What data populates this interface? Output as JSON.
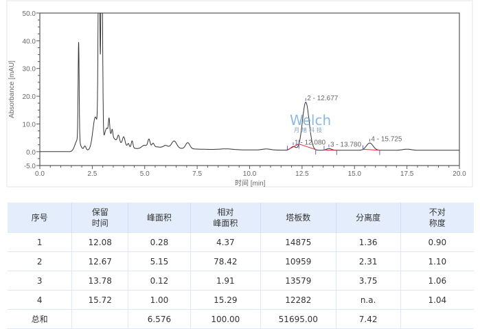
{
  "chart_data": {
    "type": "line",
    "xlabel": "时间 [min]",
    "ylabel": "Absorbance [mAU]",
    "xlim": [
      0,
      20
    ],
    "ylim": [
      -5,
      50
    ],
    "x_ticks": [
      "0.0",
      "2.5",
      "5.0",
      "7.5",
      "10.0",
      "12.5",
      "15.0",
      "17.5",
      "20.0"
    ],
    "y_ticks": [
      "50.0",
      "40.0",
      "30.0",
      "20.0",
      "10.0",
      "0.0",
      "-5.0"
    ],
    "grid": false,
    "line_color": "#333333",
    "integration_color": "#e8262a",
    "marker_color": "#5b5bd6",
    "peaks": [
      {
        "rt": 1.85,
        "height": 35.5,
        "width": 0.025
      },
      {
        "rt": 1.8,
        "height": 4,
        "width": 0.12
      },
      {
        "rt": 2.15,
        "height": 1.5,
        "width": 0.05
      },
      {
        "rt": 2.65,
        "height": 12,
        "width": 0.12
      },
      {
        "rt": 2.82,
        "height": 90,
        "width": 0.035
      },
      {
        "rt": 2.95,
        "height": 90,
        "width": 0.035
      },
      {
        "rt": 3.3,
        "height": 5,
        "width": 0.03
      },
      {
        "rt": 3.45,
        "height": 2.5,
        "width": 0.03
      },
      {
        "rt": 3.75,
        "height": 2.5,
        "width": 0.05
      },
      {
        "rt": 4.0,
        "height": 3,
        "width": 0.06
      },
      {
        "rt": 4.22,
        "height": 1.2,
        "width": 0.04
      },
      {
        "rt": 4.4,
        "height": 2.5,
        "width": 0.04
      },
      {
        "rt": 5.2,
        "height": 2.5,
        "width": 0.05
      },
      {
        "rt": 5.4,
        "height": 1.2,
        "width": 0.05
      },
      {
        "rt": 6.0,
        "height": 0.8,
        "width": 0.1
      },
      {
        "rt": 6.4,
        "height": 2.6,
        "width": 0.12
      },
      {
        "rt": 7.05,
        "height": 2.2,
        "width": 0.1
      },
      {
        "rt": 8.9,
        "height": 0.3,
        "width": 0.3
      },
      {
        "rt": 10.8,
        "height": 0.4,
        "width": 0.2
      },
      {
        "rt": 12.08,
        "height": 1.3,
        "width": 0.12
      },
      {
        "rt": 12.677,
        "height": 17.3,
        "width": 0.16
      },
      {
        "rt": 13.78,
        "height": 0.6,
        "width": 0.12
      },
      {
        "rt": 15.725,
        "height": 2.6,
        "width": 0.16
      },
      {
        "rt": 17.5,
        "height": 0.4,
        "width": 0.2
      }
    ],
    "broad_components": [
      {
        "rt": 3.2,
        "height": 8,
        "decay": 0.55
      },
      {
        "rt": 5.0,
        "height": 1.5,
        "decay": 2.0
      }
    ],
    "labeled_peaks": [
      {
        "label": "1 - 12.080",
        "rt": 12.08,
        "start": 11.8,
        "end": 12.35
      },
      {
        "label": "2 - 12.677",
        "rt": 12.677,
        "start": 12.35,
        "end": 13.15
      },
      {
        "label": "3 - 13.780",
        "rt": 13.78,
        "start": 13.55,
        "end": 14.15
      },
      {
        "label": "4 - 15.725",
        "rt": 15.725,
        "start": 15.4,
        "end": 16.2
      }
    ]
  },
  "watermark": {
    "brand": "Welch",
    "subtitle": "月旭科技"
  },
  "table": {
    "headers": [
      [
        "序号"
      ],
      [
        "保留",
        "时间"
      ],
      [
        "峰面积"
      ],
      [
        "相对",
        "峰面积"
      ],
      [
        "塔板数"
      ],
      [
        "分离度"
      ],
      [
        "不对",
        "称度"
      ]
    ],
    "rows": [
      [
        "1",
        "12.08",
        "0.28",
        "4.37",
        "14875",
        "1.36",
        "0.90"
      ],
      [
        "2",
        "12.67",
        "5.15",
        "78.42",
        "10959",
        "2.31",
        "1.10"
      ],
      [
        "3",
        "13.78",
        "0.12",
        "1.91",
        "13579",
        "3.75",
        "1.06"
      ],
      [
        "4",
        "15.72",
        "1.00",
        "15.29",
        "12282",
        "n.a.",
        "1.04"
      ],
      [
        "总和",
        "",
        "6.576",
        "100.00",
        "51695.00",
        "7.42",
        ""
      ]
    ]
  }
}
